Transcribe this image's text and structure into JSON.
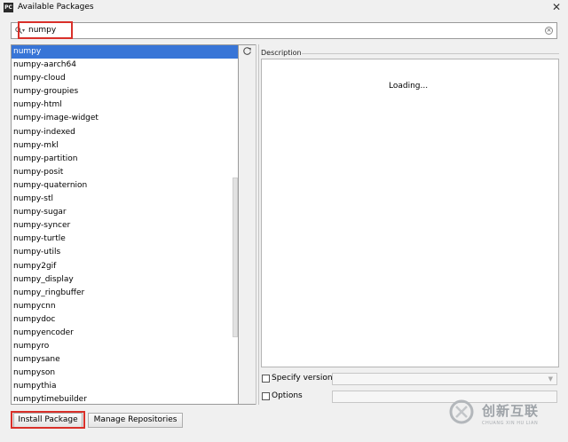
{
  "window": {
    "title": "Available Packages",
    "app_icon_text": "PC"
  },
  "search": {
    "value": "numpy"
  },
  "packages": [
    "numpy",
    "numpy-aarch64",
    "numpy-cloud",
    "numpy-groupies",
    "numpy-html",
    "numpy-image-widget",
    "numpy-indexed",
    "numpy-mkl",
    "numpy-partition",
    "numpy-posit",
    "numpy-quaternion",
    "numpy-stl",
    "numpy-sugar",
    "numpy-syncer",
    "numpy-turtle",
    "numpy-utils",
    "numpy2gif",
    "numpy_display",
    "numpy_ringbuffer",
    "numpycnn",
    "numpydoc",
    "numpyencoder",
    "numpyro",
    "numpysane",
    "numpyson",
    "numpythia",
    "numpytimebuilder"
  ],
  "selected_package": "numpy",
  "description": {
    "label": "Description",
    "status": "Loading..."
  },
  "options": {
    "specify_version_label": "Specify version",
    "options_label": "Options"
  },
  "buttons": {
    "install": "Install Package",
    "manage": "Manage Repositories"
  },
  "watermark": {
    "title": "创新互联",
    "subtitle": "CHUANG XIN HU LIAN"
  },
  "icons": {
    "search": "search-icon",
    "clear": "clear-icon",
    "reload": "reload-icon",
    "dropdown": "chevron-down-icon"
  },
  "colors": {
    "selection": "#3875d7",
    "highlight_box": "#d9302a"
  }
}
